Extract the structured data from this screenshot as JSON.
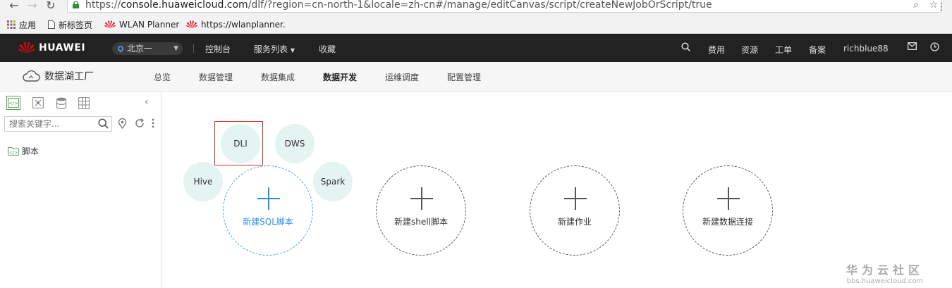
{
  "browser": {
    "url_scheme": "https://",
    "url_host": "console.huaweicloud.com",
    "url_path": "/dlf/?region=cn-north-1&locale=zh-cn#/manage/editCanvas/script/createNewJobOrScript/true",
    "bookmarks": [
      {
        "label": "应用",
        "icon": "apps-grid-icon"
      },
      {
        "label": "新标签页",
        "icon": "page-icon"
      },
      {
        "label": "WLAN Planner",
        "icon": "huawei-logo-icon"
      },
      {
        "label": "https://wlanplanner.",
        "icon": "huawei-logo-icon"
      }
    ]
  },
  "header": {
    "brand": "HUAWEI",
    "region": "北京一",
    "nav": [
      "控制台",
      "服务列表",
      "收藏"
    ],
    "right": {
      "fee": "费用",
      "resource": "资源",
      "ticket": "工单",
      "filing": "备案",
      "user": "richblue88"
    }
  },
  "service": {
    "title": "数据湖工厂",
    "tabs": [
      "总览",
      "数据管理",
      "数据集成",
      "数据开发",
      "运维调度",
      "配置管理"
    ],
    "active_tab": "数据开发"
  },
  "sidebar": {
    "search_placeholder": "搜索关键字...",
    "tree": [
      {
        "label": "脚本"
      }
    ]
  },
  "canvas": {
    "engines": [
      "DLI",
      "DWS",
      "Hive",
      "Spark"
    ],
    "highlighted_engine": "DLI",
    "cards": [
      "新建SQL脚本",
      "新建shell脚本",
      "新建作业",
      "新建数据连接"
    ],
    "active_card": "新建SQL脚本"
  },
  "watermark": {
    "title": "华为云社区",
    "url": "bbs.huaweicloud.com"
  },
  "colors": {
    "header_bg": "#222222",
    "accent_blue": "#2d8ee3",
    "engine_bubble": "#e3f4f1",
    "highlight_red": "#d9302c",
    "brand_red": "#e60012"
  }
}
